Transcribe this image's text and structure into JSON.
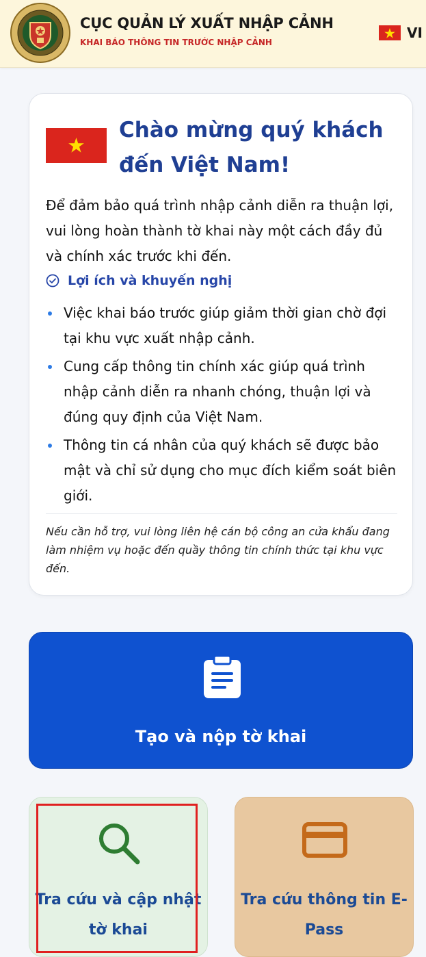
{
  "header": {
    "title": "CỤC QUẢN LÝ XUẤT NHẬP CẢNH",
    "subtitle": "KHAI BÁO THÔNG TIN TRƯỚC NHẬP CẢNH",
    "logo_icon": "immigration-emblem-icon",
    "language": {
      "flag_icon": "vietnam-flag-icon",
      "label": "VI"
    }
  },
  "welcome": {
    "flag_icon": "vietnam-flag-icon",
    "title": "Chào mừng quý khách đến Việt Nam!",
    "intro": "Để đảm bảo quá trình nhập cảnh diễn ra thuận lợi, vui lòng hoàn thành tờ khai này một cách đầy đủ và chính xác trước khi đến.",
    "benefits_icon": "check-circle-icon",
    "benefits_title": "Lợi ích và khuyến nghị",
    "benefits": [
      "Việc khai báo trước giúp giảm thời gian chờ đợi tại khu vực xuất nhập cảnh.",
      "Cung cấp thông tin chính xác giúp quá trình nhập cảnh diễn ra nhanh chóng, thuận lợi và đúng quy định của Việt Nam.",
      "Thông tin cá nhân của quý khách sẽ được bảo mật và chỉ sử dụng cho mục đích kiểm soát biên giới."
    ],
    "note": "Nếu cần hỗ trợ, vui lòng liên hệ cán bộ công an cửa khẩu đang làm nhiệm vụ hoặc đến quầy thông tin chính thức tại khu vực đến."
  },
  "actions": {
    "create": {
      "label": "Tạo và nộp tờ khai",
      "icon": "clipboard-document-icon"
    },
    "lookup": {
      "label": "Tra cứu và cập nhật tờ khai",
      "icon": "search-icon"
    },
    "epass": {
      "label": "Tra cứu thông tin E-Pass",
      "icon": "credit-card-icon"
    }
  },
  "colors": {
    "header_bg": "#fdf6dc",
    "primary_blue": "#0f52d0",
    "title_blue": "#1f3f93",
    "subtitle_red": "#c62828",
    "lookup_tile_bg": "#e4f2e4",
    "epass_tile_bg": "#e8c8a0",
    "highlight_red": "#e02020"
  }
}
